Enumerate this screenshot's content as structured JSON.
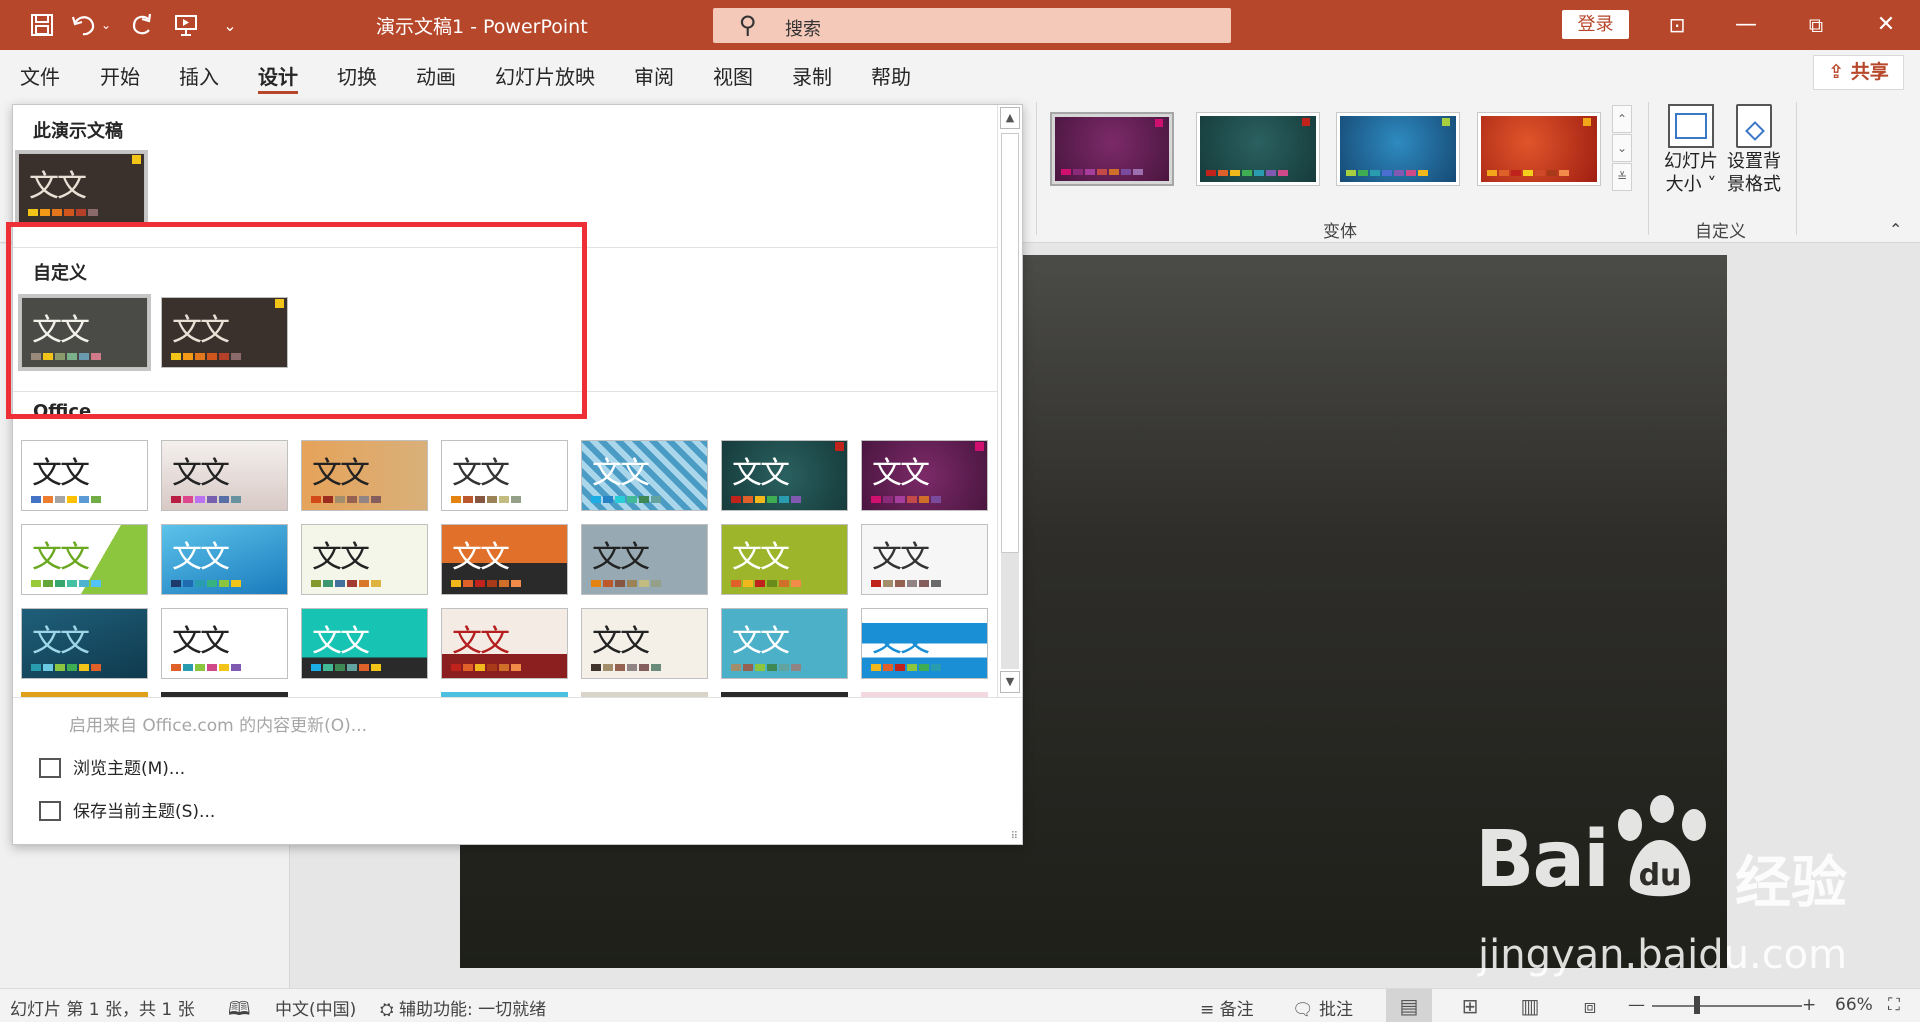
{
  "titlebar": {
    "doc_title": "演示文稿1  -  PowerPoint",
    "search_placeholder": "搜索",
    "login_label": "登录",
    "min_label": "—",
    "restore_label": "⧉",
    "close_label": "✕",
    "ribbon_display_label": "⊡"
  },
  "menu": {
    "items": [
      "文件",
      "开始",
      "插入",
      "设计",
      "切换",
      "动画",
      "幻灯片放映",
      "审阅",
      "视图",
      "录制",
      "帮助"
    ],
    "active": "设计",
    "share_label": "共享"
  },
  "ribbon": {
    "variants_group_label": "变体",
    "customize_group_label": "自定义",
    "slide_size_label_1": "幻灯片",
    "slide_size_label_2": "大小 ˅",
    "format_bg_label_1": "设置背",
    "format_bg_label_2": "景格式",
    "variants": [
      {
        "bg": "#6b2458",
        "accent": "#d0106f"
      },
      {
        "bg": "#1f4f4f",
        "accent": "#c0221c"
      },
      {
        "bg": "#1e5f8a",
        "accent": "#a8cf3d"
      },
      {
        "bg": "#b8361e",
        "accent": "#f2a71b"
      }
    ]
  },
  "gallery": {
    "section_this": "此演示文稿",
    "section_custom": "自定义",
    "section_office": "Office",
    "theme_sample_text": "文文",
    "enable_updates": "启用来自 Office.com 的内容更新(O)...",
    "browse_themes": "浏览主题(M)...",
    "save_theme": "保存当前主题(S)..."
  },
  "statusbar": {
    "slide_info": "幻灯片 第 1 张，共 1 张",
    "language": "中文(中国)",
    "accessibility": "辅助功能: 一切就绪",
    "notes": "备注",
    "comments": "批注",
    "zoom_minus": "—",
    "zoom_plus": "+",
    "zoom": "66%"
  },
  "watermark": {
    "brand": "Bai",
    "suffix": "经验",
    "url": "jingyan.baidu.com"
  },
  "colors": {
    "accent": "#b7472a",
    "highlight_box": "#ee2f36"
  }
}
